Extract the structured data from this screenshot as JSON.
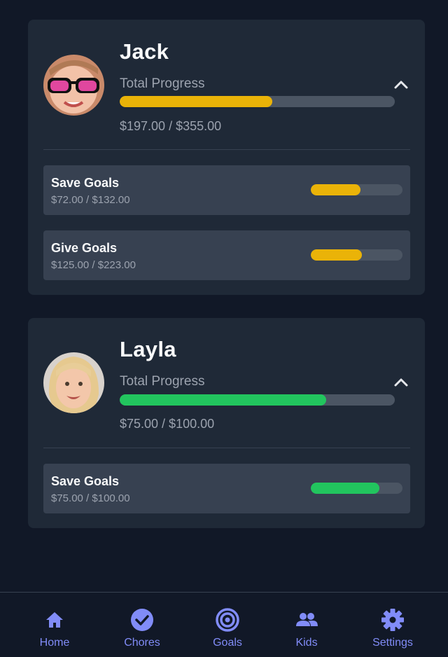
{
  "kids": [
    {
      "name": "Jack",
      "total_label": "Total Progress",
      "total_amount": "$197.00 / $355.00",
      "total_progress": 0.555,
      "color": "#eab308",
      "goals": [
        {
          "title": "Save Goals",
          "amount": "$72.00 / $132.00",
          "progress": 0.545
        },
        {
          "title": "Give Goals",
          "amount": "$125.00 / $223.00",
          "progress": 0.56
        }
      ]
    },
    {
      "name": "Layla",
      "total_label": "Total Progress",
      "total_amount": "$75.00 / $100.00",
      "total_progress": 0.75,
      "color": "#22c55e",
      "goals": [
        {
          "title": "Save Goals",
          "amount": "$75.00 / $100.00",
          "progress": 0.75
        }
      ]
    }
  ],
  "nav": {
    "items": [
      {
        "label": "Home",
        "icon": "home-icon"
      },
      {
        "label": "Chores",
        "icon": "check-circle-icon"
      },
      {
        "label": "Goals",
        "icon": "target-icon"
      },
      {
        "label": "Kids",
        "icon": "people-icon"
      },
      {
        "label": "Settings",
        "icon": "gear-icon"
      }
    ],
    "accent": "#818cf8"
  }
}
